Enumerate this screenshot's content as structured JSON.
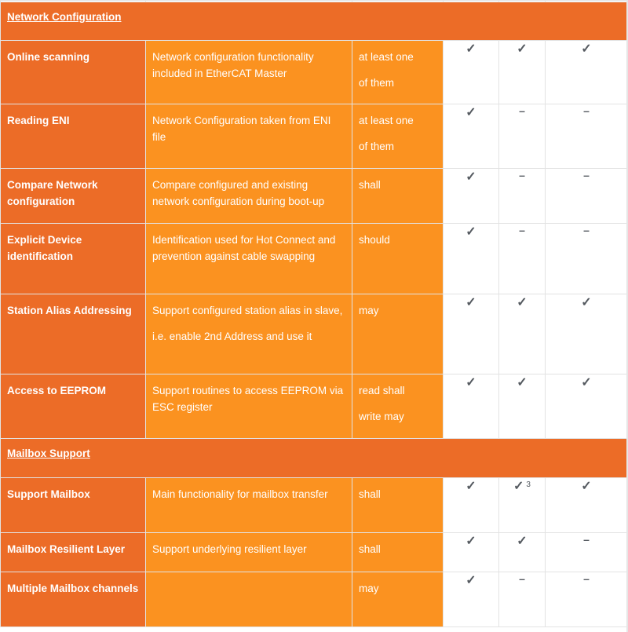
{
  "colors": {
    "section_bg": "#ec6c27",
    "feature_bg": "#ec6c27",
    "description_bg": "#fb9220",
    "value_bg": "#ffffff",
    "mark_color": "#555a60",
    "border": "#e3e3e3"
  },
  "icons": {
    "check": "✓",
    "dash": "–"
  },
  "sections": [
    {
      "title": "Network Configuration",
      "rows": [
        {
          "feature": "Online scanning",
          "description": [
            "Network configuration functionality included in EtherCAT Master"
          ],
          "requirement": [
            "at least one",
            "of them"
          ],
          "values": [
            {
              "mark": "✓",
              "type": "check",
              "note": ""
            },
            {
              "mark": "✓",
              "type": "check",
              "note": ""
            },
            {
              "mark": "✓",
              "type": "check",
              "note": ""
            }
          ]
        },
        {
          "feature": "Reading ENI",
          "description": [
            "Network Configuration taken from ENI file"
          ],
          "requirement": [
            "at least one",
            "of them"
          ],
          "values": [
            {
              "mark": "✓",
              "type": "check",
              "note": ""
            },
            {
              "mark": "–",
              "type": "dash",
              "note": ""
            },
            {
              "mark": "–",
              "type": "dash",
              "note": ""
            }
          ]
        },
        {
          "feature": "Compare Network configuration",
          "description": [
            "Compare configured and existing network configuration during boot-up"
          ],
          "requirement": [
            "shall"
          ],
          "values": [
            {
              "mark": "✓",
              "type": "check",
              "note": ""
            },
            {
              "mark": "–",
              "type": "dash",
              "note": ""
            },
            {
              "mark": "–",
              "type": "dash",
              "note": ""
            }
          ]
        },
        {
          "feature": "Explicit Device identification",
          "description": [
            "Identification used for Hot Connect and prevention against cable swapping"
          ],
          "requirement": [
            "should"
          ],
          "values": [
            {
              "mark": "✓",
              "type": "check",
              "note": ""
            },
            {
              "mark": "–",
              "type": "dash",
              "note": ""
            },
            {
              "mark": "–",
              "type": "dash",
              "note": ""
            }
          ]
        },
        {
          "feature": "Station Alias Addressing",
          "description": [
            "Support configured station alias in slave,",
            "i.e. enable 2nd Address and use it"
          ],
          "requirement": [
            "may"
          ],
          "values": [
            {
              "mark": "✓",
              "type": "check",
              "note": ""
            },
            {
              "mark": "✓",
              "type": "check",
              "note": ""
            },
            {
              "mark": "✓",
              "type": "check",
              "note": ""
            }
          ]
        },
        {
          "feature": "Access to EEPROM",
          "description": [
            "Support routines to access EEPROM via ESC register"
          ],
          "requirement": [
            "read shall",
            "write may"
          ],
          "values": [
            {
              "mark": "✓",
              "type": "check",
              "note": ""
            },
            {
              "mark": "✓",
              "type": "check",
              "note": ""
            },
            {
              "mark": "✓",
              "type": "check",
              "note": ""
            }
          ]
        }
      ]
    },
    {
      "title": "Mailbox Support",
      "rows": [
        {
          "feature": "Support Mailbox",
          "description": [
            "Main functionality for mailbox transfer"
          ],
          "requirement": [
            "shall"
          ],
          "values": [
            {
              "mark": "✓",
              "type": "check",
              "note": ""
            },
            {
              "mark": "✓",
              "type": "check",
              "note": "3"
            },
            {
              "mark": "✓",
              "type": "check",
              "note": ""
            }
          ]
        },
        {
          "feature": "Mailbox Resilient Layer",
          "description": [
            "Support underlying resilient layer"
          ],
          "requirement": [
            "shall"
          ],
          "values": [
            {
              "mark": "✓",
              "type": "check",
              "note": ""
            },
            {
              "mark": "✓",
              "type": "check",
              "note": ""
            },
            {
              "mark": "–",
              "type": "dash",
              "note": ""
            }
          ]
        },
        {
          "feature": "Multiple Mailbox channels",
          "description": [
            ""
          ],
          "requirement": [
            "may"
          ],
          "values": [
            {
              "mark": "✓",
              "type": "check",
              "note": ""
            },
            {
              "mark": "–",
              "type": "dash",
              "note": ""
            },
            {
              "mark": "–",
              "type": "dash",
              "note": ""
            }
          ]
        }
      ]
    }
  ]
}
